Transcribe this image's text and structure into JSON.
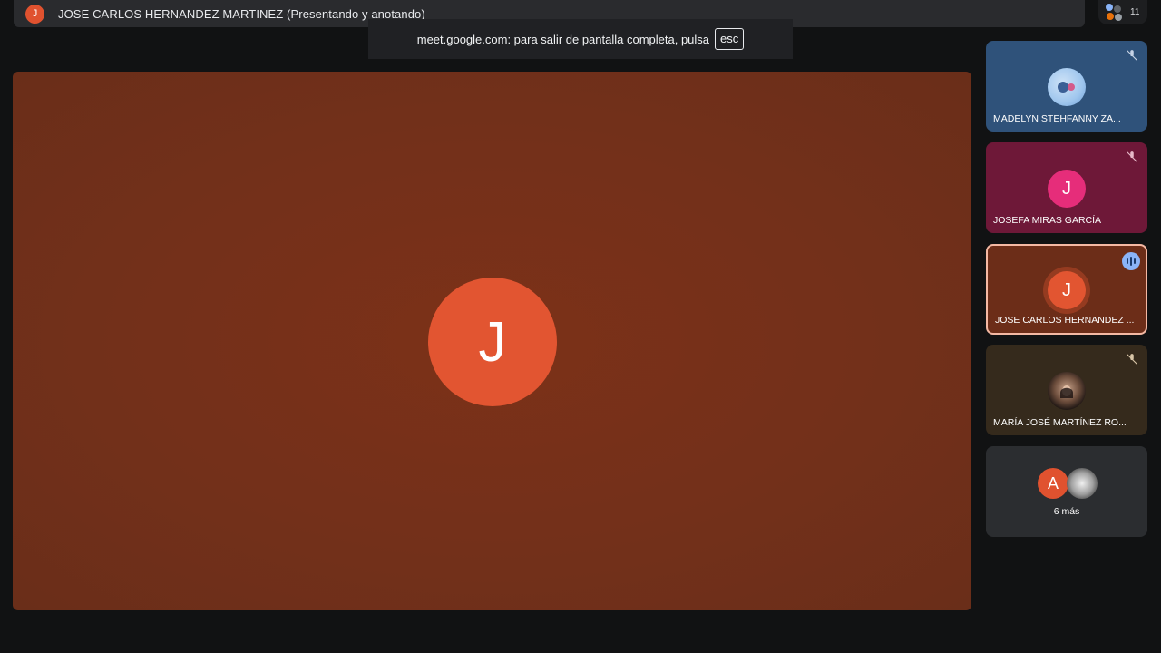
{
  "presenter_bar": {
    "avatar_letter": "J",
    "title": "JOSE CARLOS HERNANDEZ MARTINEZ (Presentando y anotando)"
  },
  "participants_count": "11",
  "fullscreen_toast": {
    "message": "meet.google.com: para salir de pantalla completa, pulsa",
    "key": "esc"
  },
  "main_stage": {
    "avatar_letter": "J"
  },
  "tiles": [
    {
      "name": "MADELYN STEHFANNY ZA...",
      "mic": "muted",
      "avatar": "photo"
    },
    {
      "name": "JOSEFA MIRAS GARCÍA",
      "mic": "muted",
      "avatar_letter": "J"
    },
    {
      "name": "JOSE CARLOS HERNANDEZ ...",
      "mic": "speaking",
      "avatar_letter": "J"
    },
    {
      "name": "MARÍA JOSÉ MARTÍNEZ RO...",
      "mic": "muted",
      "avatar": "photo"
    }
  ],
  "more_tile": {
    "avatar_letter": "A",
    "label": "6 más"
  },
  "colors": {
    "stage": "#73301a",
    "accent_orange": "#e25531",
    "speaking_blue": "#8ab4f8"
  }
}
